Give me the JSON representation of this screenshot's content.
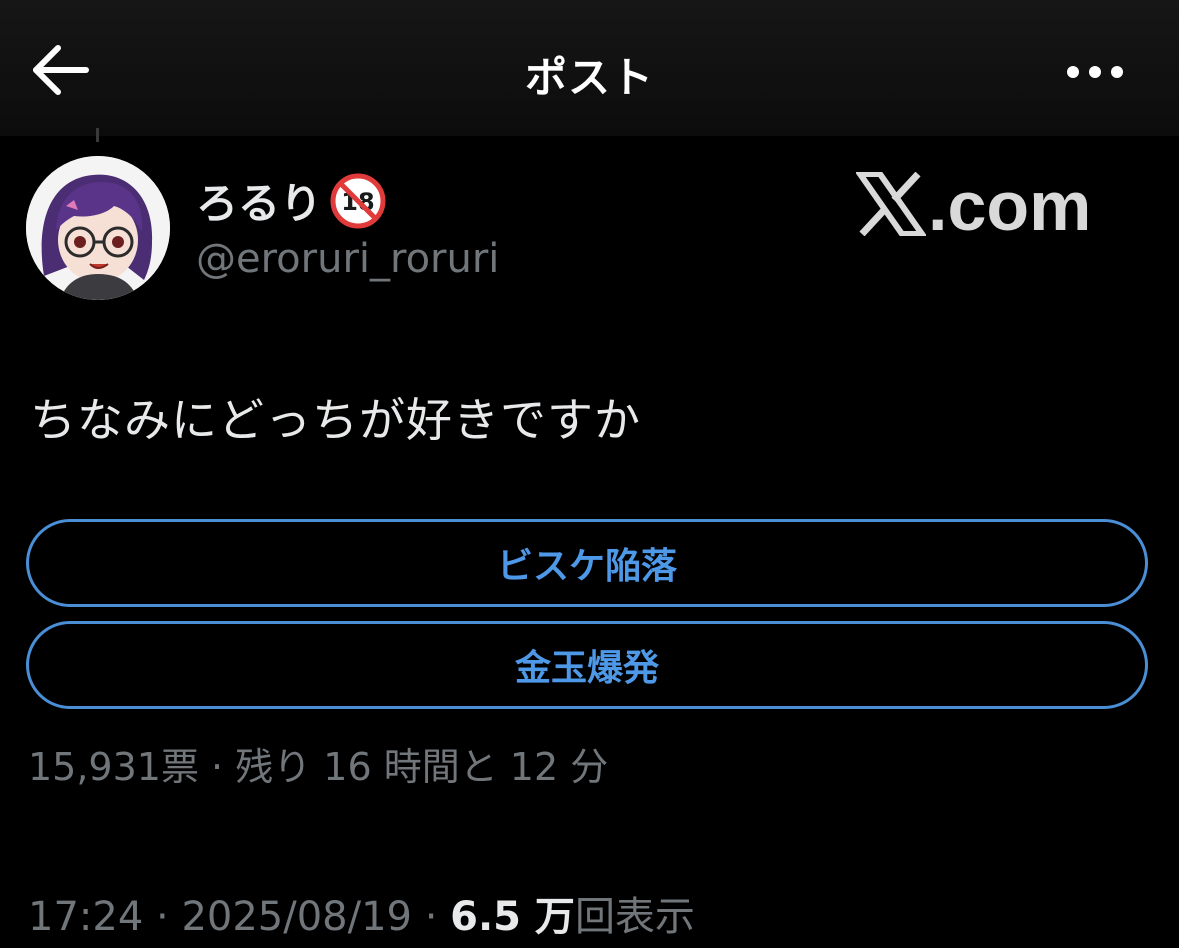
{
  "header": {
    "title": "ポスト",
    "back_icon": "arrow-left-icon",
    "more_icon": "more-horizontal-icon"
  },
  "author": {
    "display_name": "ろるり",
    "badge": "🔞",
    "badge_icon": "no-under-18-icon",
    "handle": "@eroruri_roruri"
  },
  "watermark": {
    "text": ".com",
    "logo_icon": "x-logo-icon"
  },
  "post": {
    "text": "ちなみにどっちが好きですか"
  },
  "poll": {
    "options": [
      {
        "label": "ビスケ陥落"
      },
      {
        "label": "金玉爆発"
      }
    ],
    "meta": "15,931票 · 残り 16 時間と 12 分"
  },
  "meta": {
    "time": "17:24",
    "separator": "·",
    "date": "2025/08/19",
    "views_count": "6.5 万",
    "views_label": "回表示"
  },
  "colors": {
    "accent": "#4e98e8",
    "text_primary": "#e7e9ea",
    "text_secondary": "#71767b",
    "background": "#000000"
  }
}
